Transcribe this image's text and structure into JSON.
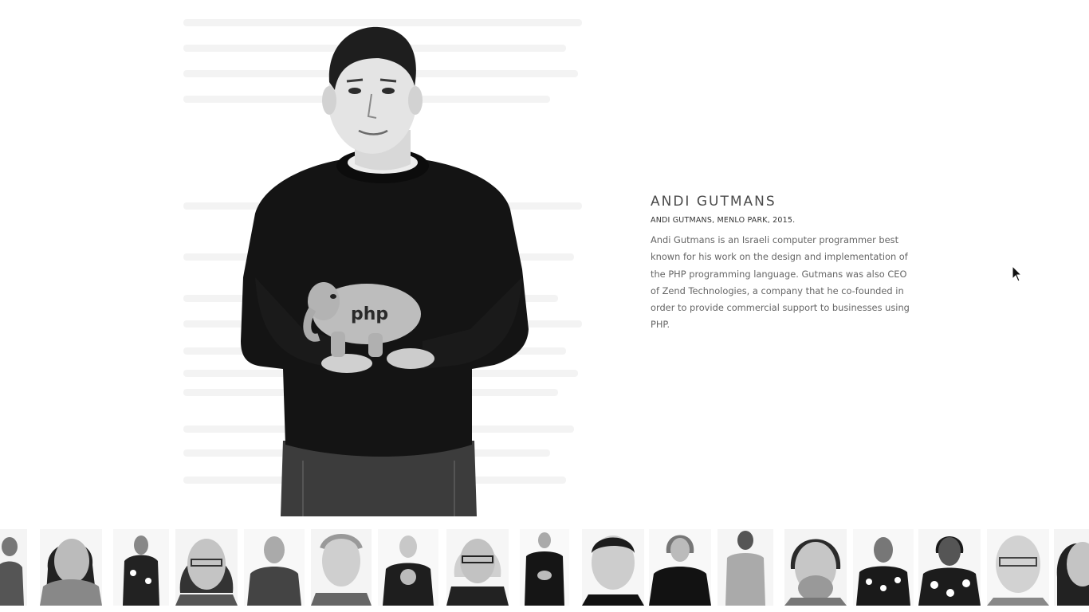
{
  "profile": {
    "name": "ANDI GUTMANS",
    "caption": "ANDI GUTMANS, MENLO PARK, 2015.",
    "bio": "Andi Gutmans is an Israeli computer programmer best known for his work on the design and implementation of the PHP programming language. Gutmans was also CEO of Zend Technologies, a company that he co-founded in order to provide commercial support to businesses using PHP.",
    "held_object_text": "php"
  },
  "icons": {
    "cursor": "mouse-pointer-icon"
  },
  "thumbnails": [
    {
      "label": "portrait-1",
      "variant": "standing"
    },
    {
      "label": "portrait-2",
      "variant": "close"
    },
    {
      "label": "portrait-3",
      "variant": "standing"
    },
    {
      "label": "portrait-4",
      "variant": "close"
    },
    {
      "label": "portrait-5",
      "variant": "standing"
    },
    {
      "label": "portrait-6",
      "variant": "close"
    },
    {
      "label": "portrait-7",
      "variant": "standing"
    },
    {
      "label": "portrait-8",
      "variant": "close"
    },
    {
      "label": "portrait-9",
      "variant": "standing"
    },
    {
      "label": "portrait-10",
      "variant": "close"
    },
    {
      "label": "portrait-11",
      "variant": "standing"
    },
    {
      "label": "portrait-12",
      "variant": "standing"
    },
    {
      "label": "portrait-13",
      "variant": "close"
    },
    {
      "label": "portrait-14",
      "variant": "standing"
    },
    {
      "label": "portrait-15",
      "variant": "standing"
    },
    {
      "label": "portrait-16",
      "variant": "close"
    },
    {
      "label": "portrait-17",
      "variant": "close"
    }
  ],
  "colors": {
    "background": "#ffffff",
    "heading": "#4a4a4a",
    "body_text": "#666666"
  }
}
